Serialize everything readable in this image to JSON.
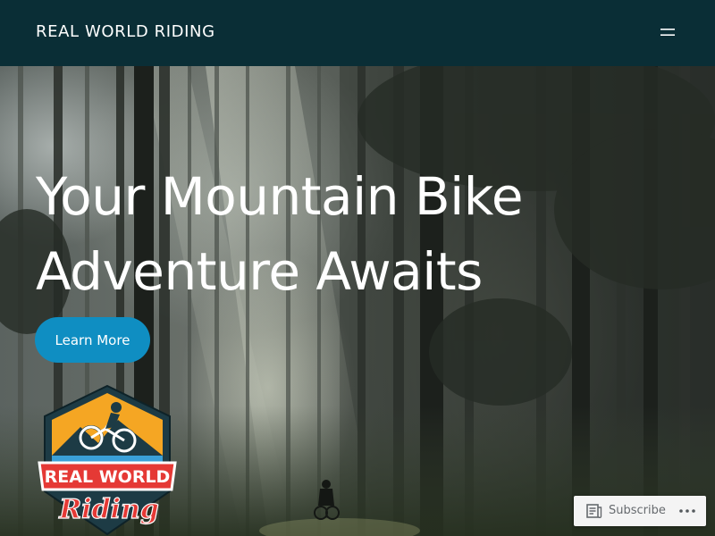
{
  "header": {
    "site_title": "REAL WORLD RIDING",
    "menu_icon": "hamburger-menu-icon",
    "background_color": "#0a2e36"
  },
  "hero": {
    "title_line1": "Your Mountain Bike",
    "title_line2": "Adventure Awaits",
    "cta_label": "Learn More",
    "cta_color": "#0f8ec2"
  },
  "logo": {
    "text_line1": "REAL WORLD",
    "text_line2": "Riding",
    "icon": "mountain-biker-badge-logo"
  },
  "subscribe_bar": {
    "subscribe_label": "Subscribe",
    "subscribe_icon": "reader-icon",
    "more_icon": "ellipsis-icon"
  }
}
